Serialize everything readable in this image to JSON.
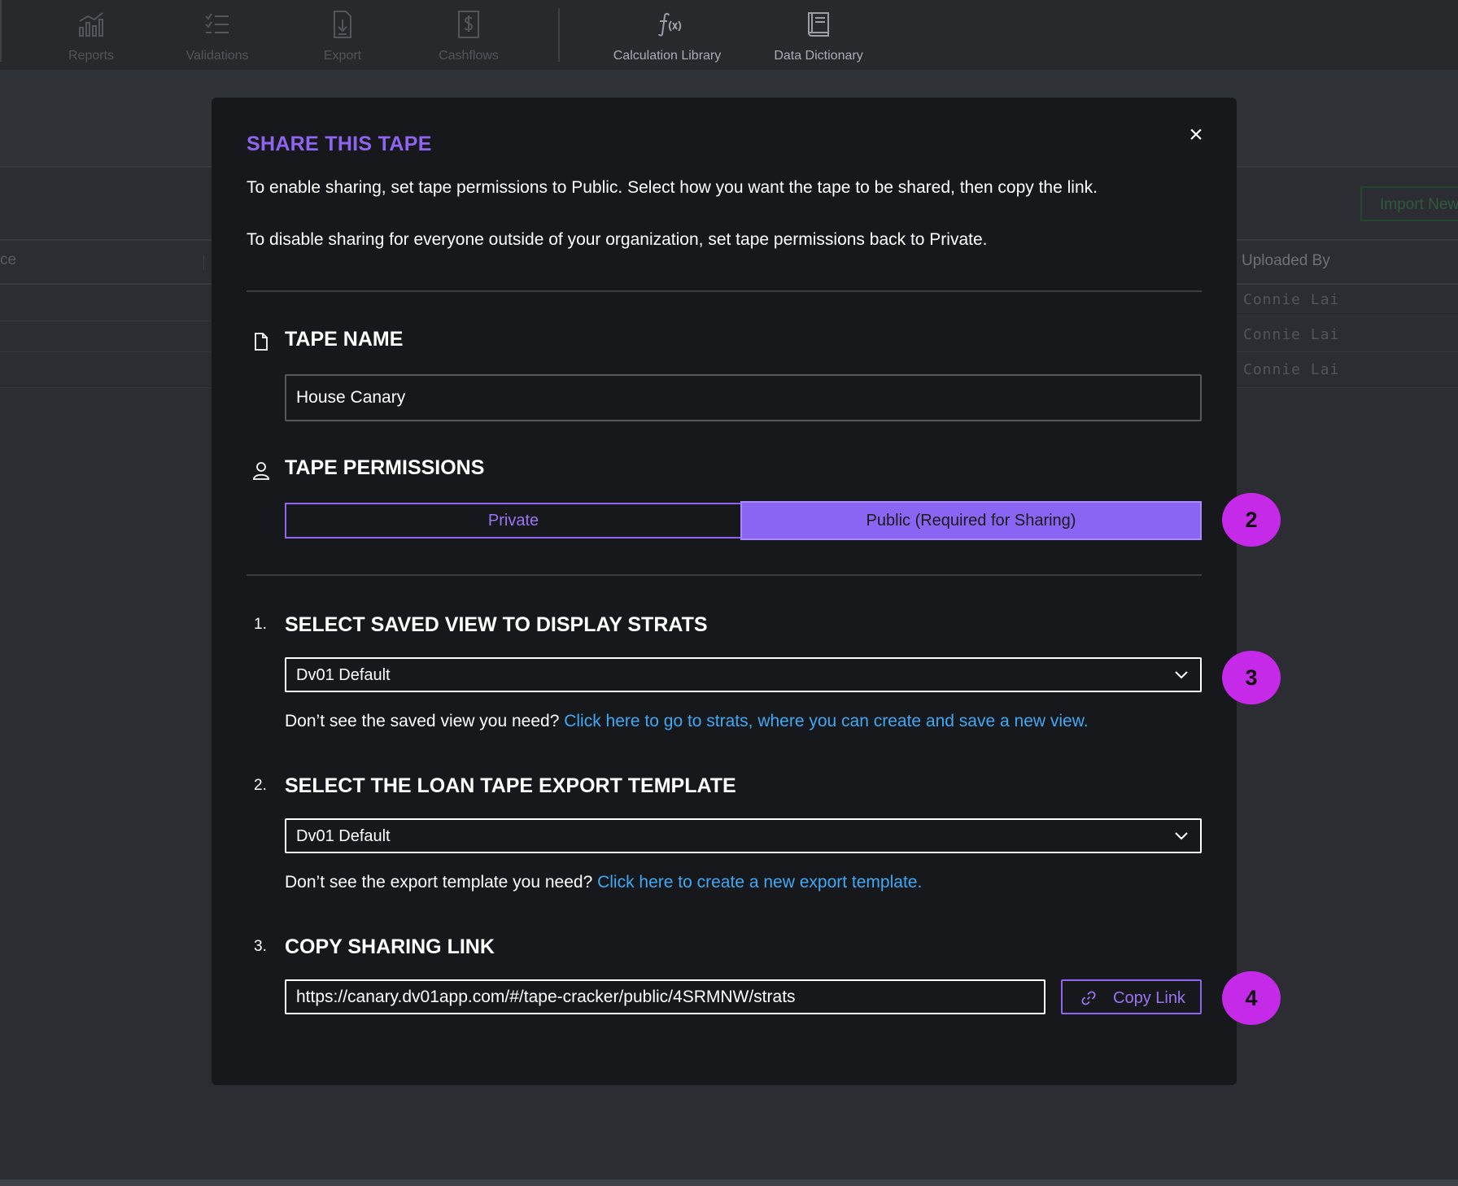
{
  "nav": {
    "items": [
      {
        "label": "Reports",
        "icon": "bar-chart-icon"
      },
      {
        "label": "Validations",
        "icon": "checklist-icon"
      },
      {
        "label": "Export",
        "icon": "export-file-icon"
      },
      {
        "label": "Cashflows",
        "icon": "dollar-file-icon"
      },
      {
        "label": "Calculation Library",
        "icon": "function-icon"
      },
      {
        "label": "Data Dictionary",
        "icon": "book-icon"
      }
    ]
  },
  "background": {
    "import_button": "Import New",
    "left_col_fragment": "ce",
    "uploaded_by_header": "Uploaded By",
    "uploaded_by_rows": [
      "Connie Lai",
      "Connie Lai",
      "Connie Lai"
    ]
  },
  "modal": {
    "title": "SHARE THIS TAPE",
    "close": "×",
    "intro_1": "To enable sharing, set tape permissions to Public. Select how you want the tape to be shared, then copy the link.",
    "intro_2": "To disable sharing for everyone outside of your organization, set tape permissions back to Private.",
    "tape_name": {
      "title": "TAPE NAME",
      "value": "House Canary"
    },
    "permissions": {
      "title": "TAPE PERMISSIONS",
      "private_label": "Private",
      "public_label": "Public (Required for Sharing)",
      "selected": "Public"
    },
    "step1": {
      "num": "1.",
      "title": "SELECT SAVED VIEW TO DISPLAY STRATS",
      "selected": "Dv01 Default",
      "help_text": "Don’t see the saved view you need? ",
      "help_link": "Click here to go to strats, where you can create and save a new view."
    },
    "step2": {
      "num": "2.",
      "title": "SELECT THE LOAN TAPE EXPORT TEMPLATE",
      "selected": "Dv01 Default",
      "help_text": "Don’t see the export template you need? ",
      "help_link": "Click here to create a new export template."
    },
    "step3": {
      "num": "3.",
      "title": "COPY SHARING LINK",
      "url": "https://canary.dv01app.com/#/tape-cracker/public/4SRMNW/strats",
      "copy_label": "Copy Link"
    }
  },
  "badges": [
    "2",
    "3",
    "4"
  ],
  "colors": {
    "accent": "#8d65f0",
    "badge": "#c42ae8",
    "link": "#3fa9f5"
  }
}
